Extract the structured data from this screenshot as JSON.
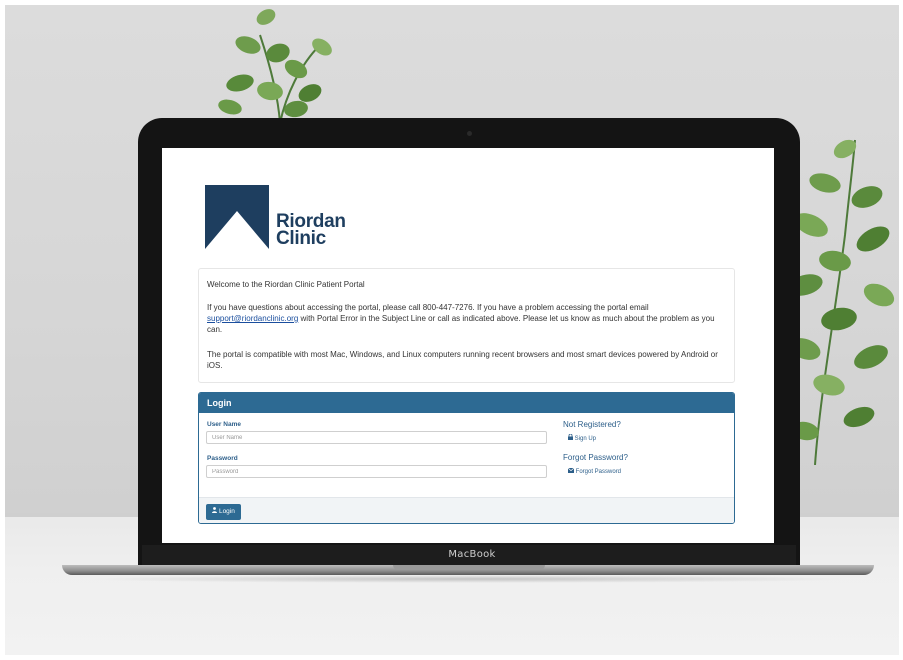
{
  "device": {
    "brand_label": "MacBook"
  },
  "logo": {
    "line1": "Riordan",
    "line2": "Clinic",
    "color": "#1e3e5f"
  },
  "welcome": {
    "heading": "Welcome to the Riordan Clinic Patient Portal",
    "para1_before": "If you have questions about accessing the portal, please call 800-447-7276.  If you have a problem accessing the portal email",
    "support_email": "support@riordanclinic.org",
    "para1_after": "with Portal Error in the Subject Line or call as indicated above.  Please let us know as much about the problem as you can.",
    "para2": "The portal is compatible with most Mac, Windows, and Linux computers running recent browsers and most smart devices powered by Android or iOS."
  },
  "login": {
    "title": "Login",
    "username_label": "User Name",
    "username_placeholder": "User Name",
    "username_value": "",
    "password_label": "Password",
    "password_placeholder": "Password",
    "password_value": "",
    "not_registered": "Not Registered?",
    "sign_up": "Sign Up",
    "sign_up_icon": "lock-icon",
    "forgot_title": "Forgot Password?",
    "forgot_link": "Forgot Password",
    "forgot_icon": "envelope-icon",
    "button_label": "Login",
    "button_icon": "user-icon",
    "accent_color": "#2d6a93"
  }
}
